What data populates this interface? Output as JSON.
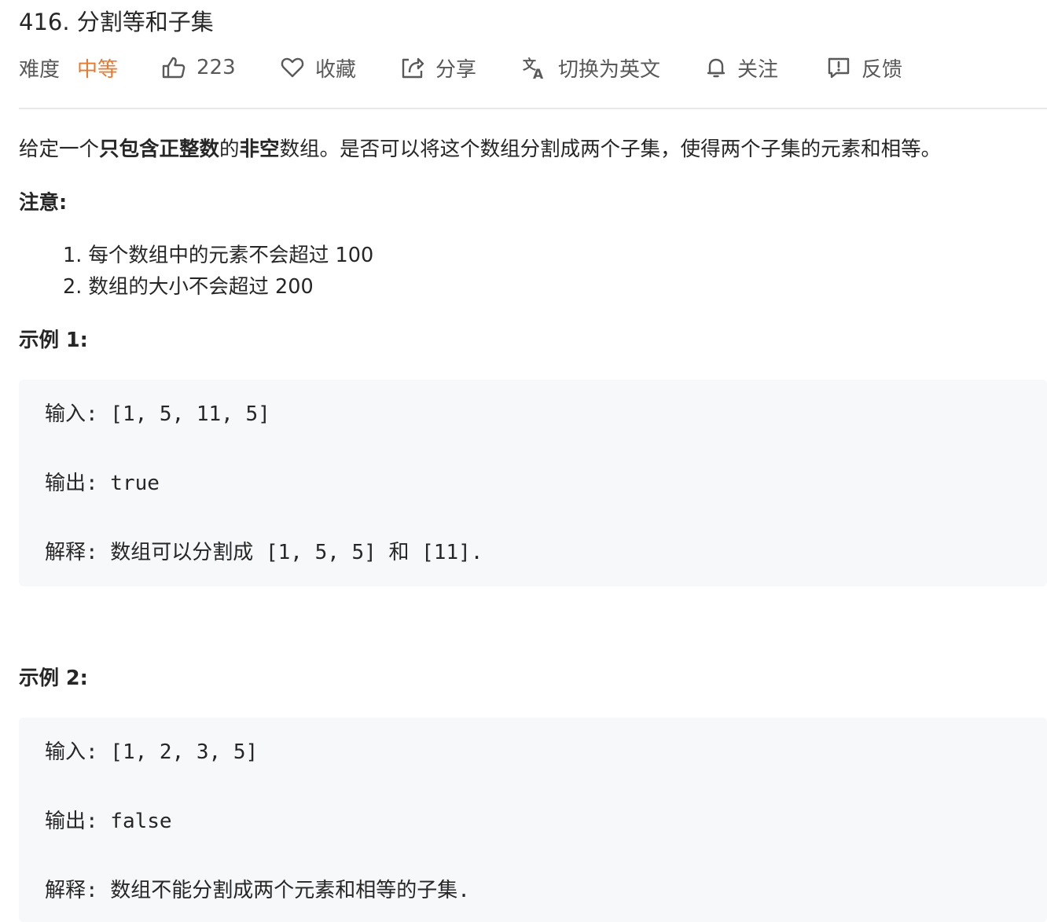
{
  "problem": {
    "title": "416. 分割等和子集"
  },
  "meta": {
    "difficulty_label": "难度",
    "difficulty_value": "中等",
    "likes": "223",
    "favorite_label": "收藏",
    "share_label": "分享",
    "translate_label": "切换为英文",
    "follow_label": "关注",
    "feedback_label": "反馈"
  },
  "description": {
    "intro_1": "给定一个",
    "intro_bold_1": "只包含正整数",
    "intro_2": "的",
    "intro_bold_2": "非空",
    "intro_3": "数组。是否可以将这个数组分割成两个子集，使得两个子集的元素和相等。",
    "note_heading": "注意:",
    "notes": [
      "1. 每个数组中的元素不会超过 100",
      "2. 数组的大小不会超过 200"
    ]
  },
  "examples": [
    {
      "heading": "示例 1:",
      "input": "输入: [1, 5, 11, 5]",
      "output": "输出: true",
      "explanation": "解释: 数组可以分割成 [1, 5, 5] 和 [11]."
    },
    {
      "heading": "示例 2:",
      "input": "输入: [1, 2, 3, 5]",
      "output": "输出: false",
      "explanation": "解释: 数组不能分割成两个元素和相等的子集."
    }
  ],
  "colors": {
    "difficulty_medium": "#e9792f",
    "text_primary": "#262626",
    "text_secondary": "#595959",
    "code_background": "#f7f8fa",
    "divider": "#e8e8e8"
  },
  "icons": [
    "thumbs-up-icon",
    "heart-icon",
    "share-icon",
    "translate-icon",
    "bell-icon",
    "feedback-icon"
  ]
}
